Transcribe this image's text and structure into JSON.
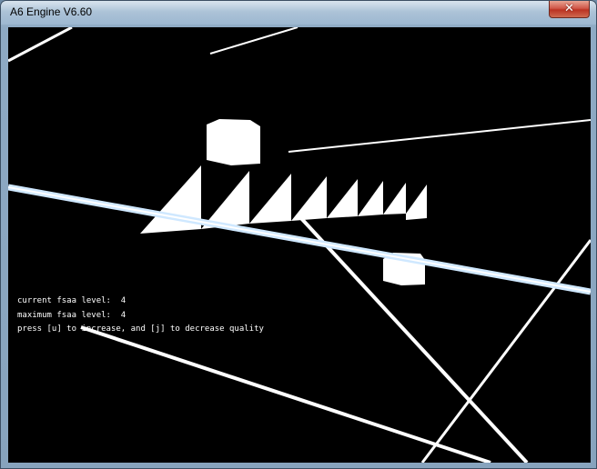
{
  "window": {
    "title": "A6 Engine V6.60",
    "close_label": "✕"
  },
  "scene": {
    "hud": {
      "current_fsaa": "current fsaa level:  4",
      "maximum_fsaa": "maximum fsaa level:  4",
      "instructions": "press [u] to increase, and [j] to decrease quality"
    }
  },
  "colors": {
    "background": "#000000",
    "geometry": "#ffffff",
    "beam": "#cfe8ff"
  }
}
